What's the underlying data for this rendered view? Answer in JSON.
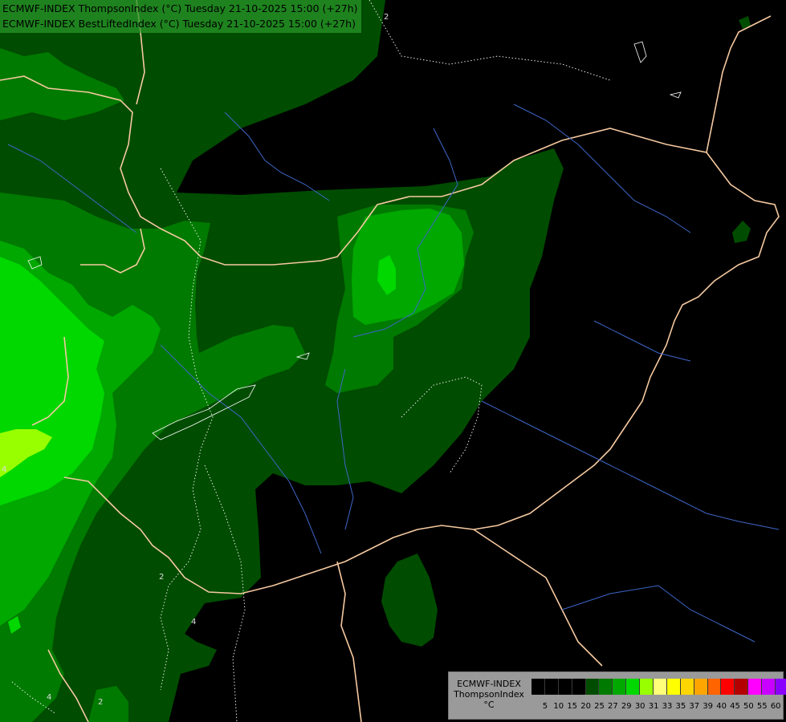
{
  "header": {
    "line1": "ECMWF-INDEX ThompsonIndex (°C) Tuesday 21-10-2025 15:00 (+27h)",
    "line2": "ECMWF-INDEX BestLiftedIndex (°C) Tuesday 21-10-2025 15:00 (+27h)"
  },
  "contour_labels": [
    "2",
    "4",
    "4",
    "2",
    "4",
    "2",
    "4"
  ],
  "legend": {
    "title_lines": [
      "ECMWF-INDEX",
      "ThompsonIndex",
      "°C"
    ],
    "colors": [
      "#000000",
      "#000000",
      "#000000",
      "#000000",
      "#004c00",
      "#007a00",
      "#00a800",
      "#00d800",
      "#98ff00",
      "#ffff7a",
      "#ffff00",
      "#ffd600",
      "#ffa500",
      "#ff6400",
      "#ff0000",
      "#b40000",
      "#ff00ff",
      "#c800ff",
      "#8a00ff",
      "#6400ff",
      "#0000ff"
    ],
    "ticks": [
      "5",
      "10",
      "15",
      "20",
      "25",
      "27",
      "29",
      "30",
      "31",
      "33",
      "35",
      "37",
      "39",
      "40",
      "45",
      "50",
      "55",
      "60"
    ]
  },
  "colors": {
    "background": "#000000",
    "dark_green": "#004c00",
    "medium_green": "#007a00",
    "green": "#00a800",
    "bright_green": "#00d800",
    "lime": "#98ff00",
    "border_line": "#f5c9a0",
    "river_line": "#3e66c8",
    "contour_line": "#ffffff"
  }
}
